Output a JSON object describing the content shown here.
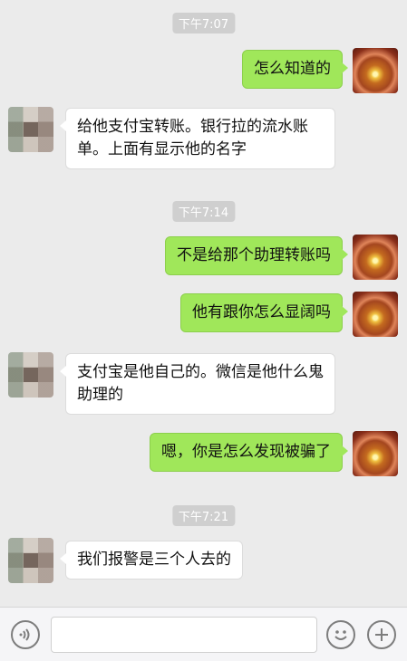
{
  "messages": {
    "t1": "下午7:07",
    "m1": "怎么知道的",
    "m2": "给他支付宝转账。银行拉的流水账单。上面有显示他的名字",
    "t2": "下午7:14",
    "m3": "不是给那个助理转账吗",
    "m4": "他有跟你怎么显阔吗",
    "m5": "支付宝是他自己的。微信是他什么鬼助理的",
    "m6": "嗯，你是怎么发现被骗了",
    "t3": "下午7:21",
    "m7": "我们报警是三个人去的"
  },
  "input": {
    "value": ""
  },
  "icons": {
    "voice": "voice-icon",
    "emoji": "emoji-icon",
    "plus": "plus-icon"
  },
  "colors": {
    "background": "#ebebeb",
    "sent_bubble": "#a0e75a",
    "received_bubble": "#ffffff",
    "timestamp_bg": "#cfcfcf"
  }
}
